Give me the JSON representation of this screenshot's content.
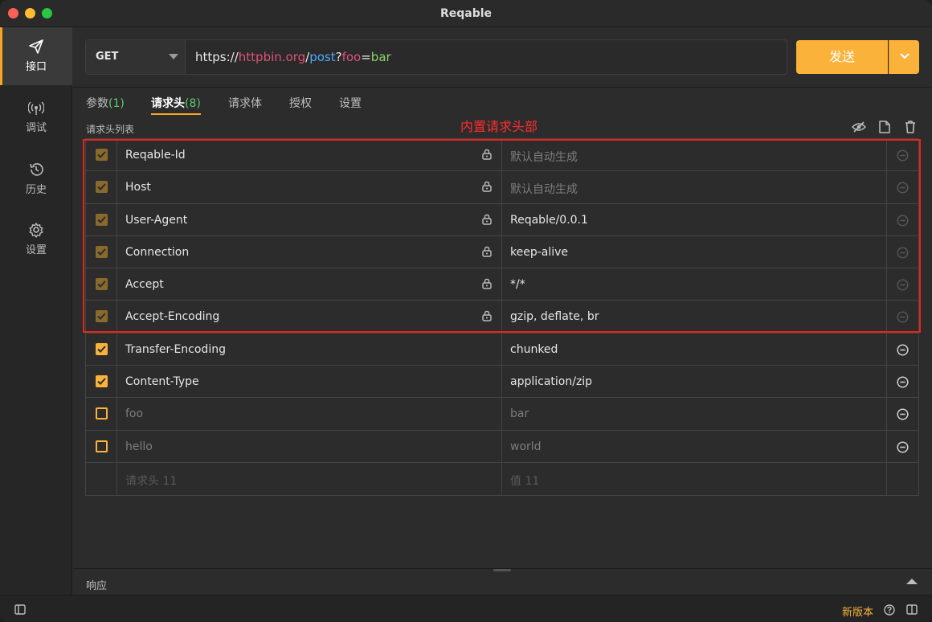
{
  "window": {
    "title": "Reqable"
  },
  "sidebar": {
    "items": [
      {
        "label": "接口",
        "icon": "send-icon",
        "active": true
      },
      {
        "label": "调试",
        "icon": "broadcast-icon",
        "active": false
      },
      {
        "label": "历史",
        "icon": "history-icon",
        "active": false
      },
      {
        "label": "设置",
        "icon": "gear-icon",
        "active": false
      }
    ]
  },
  "request": {
    "method": "GET",
    "url": {
      "scheme": "https://",
      "host": "httpbin.org",
      "slash": "/",
      "path": "post",
      "qmark": "?",
      "query_key": "foo",
      "eq": "=",
      "query_value": "bar"
    },
    "send_label": "发送"
  },
  "tabs": [
    {
      "label": "参数",
      "count": "(1)",
      "active": false
    },
    {
      "label": "请求头",
      "count": "(8)",
      "active": true
    },
    {
      "label": "请求体",
      "count": "",
      "active": false
    },
    {
      "label": "授权",
      "count": "",
      "active": false
    },
    {
      "label": "设置",
      "count": "",
      "active": false
    }
  ],
  "headers": {
    "list_label": "请求头列表",
    "annotation": "内置请求头部",
    "rows": [
      {
        "name": "Reqable-Id",
        "value": "默认自动生成",
        "checked": true,
        "builtin": true,
        "value_placeholder": true
      },
      {
        "name": "Host",
        "value": "默认自动生成",
        "checked": true,
        "builtin": true,
        "value_placeholder": true
      },
      {
        "name": "User-Agent",
        "value": "Reqable/0.0.1",
        "checked": true,
        "builtin": true,
        "value_placeholder": false
      },
      {
        "name": "Connection",
        "value": "keep-alive",
        "checked": true,
        "builtin": true,
        "value_placeholder": false
      },
      {
        "name": "Accept",
        "value": "*/*",
        "checked": true,
        "builtin": true,
        "value_placeholder": false
      },
      {
        "name": "Accept-Encoding",
        "value": "gzip, deflate, br",
        "checked": true,
        "builtin": true,
        "value_placeholder": false
      },
      {
        "name": "Transfer-Encoding",
        "value": "chunked",
        "checked": true,
        "builtin": false,
        "value_placeholder": false
      },
      {
        "name": "Content-Type",
        "value": "application/zip",
        "checked": true,
        "builtin": false,
        "value_placeholder": false
      },
      {
        "name": "foo",
        "value": "bar",
        "checked": false,
        "builtin": false,
        "value_placeholder": false
      },
      {
        "name": "hello",
        "value": "world",
        "checked": false,
        "builtin": false,
        "value_placeholder": false
      }
    ],
    "new_row": {
      "name_placeholder": "请求头 11",
      "value_placeholder": "值 11"
    }
  },
  "response": {
    "label": "响应"
  },
  "status": {
    "new_version": "新版本"
  },
  "colors": {
    "accent": "#fbb23a",
    "count": "#5fc96b",
    "annotation": "#ff2d2d"
  }
}
